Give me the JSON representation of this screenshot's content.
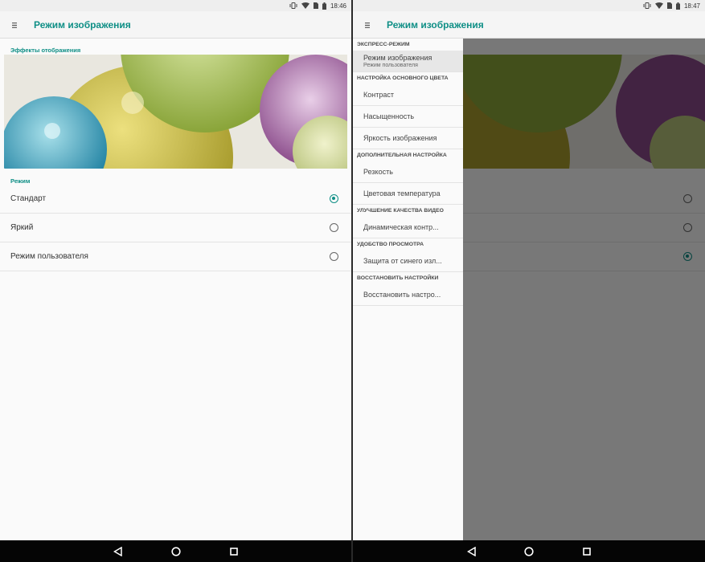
{
  "left_screen": {
    "status": {
      "time": "18:46"
    },
    "title": "Режим изображения",
    "effects_label": "Эффекты отображения",
    "mode_label": "Режим",
    "options": [
      {
        "label": "Стандарт",
        "selected": true
      },
      {
        "label": "Яркий",
        "selected": false
      },
      {
        "label": "Режим пользователя",
        "selected": false
      }
    ]
  },
  "right_screen": {
    "status": {
      "time": "18:47"
    },
    "title": "Режим изображения",
    "background_options_selected": [
      false,
      false,
      true
    ],
    "drawer": {
      "sections": [
        {
          "header": "ЭКСПРЕСС-РЕЖИМ",
          "items": [
            {
              "label": "Режим изображения",
              "sub": "Режим пользователя",
              "selected": true
            }
          ]
        },
        {
          "header": "НАСТРОЙКА ОСНОВНОГО ЦВЕТА",
          "items": [
            {
              "label": "Контраст"
            },
            {
              "label": "Насыщенность"
            },
            {
              "label": "Яркость изображения"
            }
          ]
        },
        {
          "header": "ДОПОЛНИТЕЛЬНАЯ НАСТРОЙКА",
          "items": [
            {
              "label": "Резкость"
            },
            {
              "label": "Цветовая температура"
            }
          ]
        },
        {
          "header": "УЛУЧШЕНИЕ КАЧЕСТВА ВИДЕО",
          "items": [
            {
              "label": "Динамическая контр..."
            }
          ]
        },
        {
          "header": "УДОБСТВО ПРОСМОТРА",
          "items": [
            {
              "label": "Защита от синего изл..."
            }
          ]
        },
        {
          "header": "ВОССТАНОВИТЬ НАСТРОЙКИ",
          "items": [
            {
              "label": "Восстановить настро..."
            }
          ]
        }
      ]
    }
  },
  "colors": {
    "accent": "#0f8f86",
    "navbar": "#050505",
    "background": "#fafafa"
  },
  "icons": [
    "menu-icon",
    "vibrate-icon",
    "wifi-icon",
    "sim-icon",
    "battery-icon",
    "back-icon",
    "home-icon",
    "recents-icon"
  ]
}
